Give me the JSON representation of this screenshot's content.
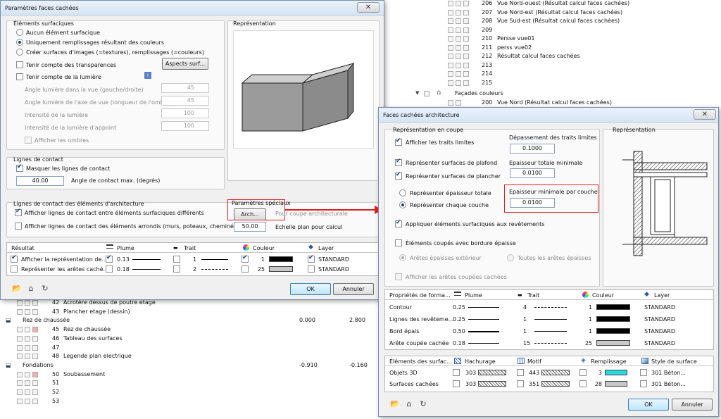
{
  "bg": {
    "top_rows": [
      {
        "num": "206",
        "label": "Vue Nord-ouest (Résultat calcul faces cachées)"
      },
      {
        "num": "207",
        "label": "Vue Nord-est (Résultat calcul faces cachées)"
      },
      {
        "num": "208",
        "label": "Vue Sud-est (Résultat calcul faces cachées)"
      },
      {
        "num": "209",
        "label": ""
      },
      {
        "num": "210",
        "label": "Persse vue01"
      },
      {
        "num": "211",
        "label": "perss vue02"
      },
      {
        "num": "212",
        "label": "Résultat calcul faces cachées"
      },
      {
        "num": "213",
        "label": ""
      },
      {
        "num": "214",
        "label": ""
      },
      {
        "num": "215",
        "label": ""
      }
    ],
    "facades_label": "Façades couleurs",
    "row_200": {
      "num": "200",
      "label": "Vue Nord (Résultat calcul faces cachées)"
    },
    "bottom_rows": [
      {
        "num": "42",
        "label": "Acrotère dessus de poutre etage"
      },
      {
        "num": "43",
        "label": "Plancher etage (dessin)"
      },
      {
        "group": "Rez de chaussée",
        "v1": "0.000",
        "v2": "2.800"
      },
      {
        "num": "45",
        "label": "Rez de chaussée"
      },
      {
        "num": "46",
        "label": "Tableau des surfaces"
      },
      {
        "num": "47",
        "label": ""
      },
      {
        "num": "48",
        "label": "Legende plan electrique"
      },
      {
        "group": "Fondations",
        "v1": "-0.910",
        "v2": "-0.160"
      },
      {
        "num": "50",
        "label": "Soubassement"
      },
      {
        "num": "51",
        "label": ""
      },
      {
        "num": "52",
        "label": ""
      },
      {
        "num": "53",
        "label": ""
      }
    ]
  },
  "dlg1": {
    "title": "Paramètres faces cachées",
    "close": "✕",
    "surf": {
      "title": "Éléments surfaciques",
      "opt1": "Aucun élément surfacique",
      "opt2": "Uniquement remplissages résultant des couleurs",
      "opt3": "Créer surfaces d'images (=textures), remplissages (=couleurs)",
      "transp": "Tenir compte des transparences",
      "aspects_btn": "Aspects surf...",
      "light": "Tenir compte de la lumière",
      "angle1": "Angle lumière dans la vue (gauche/droite)",
      "angle1_val": "45",
      "angle2": "Angle lumière de l'axe de vue (longueur de l'ombre",
      "angle2_val": "45",
      "int1": "Intensité de la lumière",
      "int1_val": "100",
      "int2": "Intensité de la lumière d'appoint",
      "int2_val": "100",
      "shadows": "Afficher les ombres"
    },
    "repr": "Représentation",
    "contact": {
      "title": "Lignes de contact",
      "hide": "Masquer les lignes de contact",
      "angle_val": "40.00",
      "angle_label": "Angle de contact max. (degrés)"
    },
    "arch": {
      "title": "Lignes de contact des éléments d'architecture",
      "opt1": "Afficher lignes de contact entre éléments surfaciques différents",
      "opt2": "Afficher lignes de contact des éléments arrondis (murs, poteaux, cheminées)",
      "special": "Paramètres spéciaux",
      "arch_btn": "Arch...",
      "for_arch": "Pour coupe architecturale",
      "scale_val": "50.00",
      "scale_label": "Echelle plan pour calcul"
    },
    "table": {
      "headers": [
        "Résultat",
        "Plume",
        "Trait",
        "Couleur",
        "Layer"
      ],
      "rows": [
        {
          "label": "Afficher la représentation de...",
          "pen": "0.13",
          "trait": "1",
          "color": "1",
          "layer": "STANDARD"
        },
        {
          "label": "Représenter les arêtes caché...",
          "pen": "0.18",
          "trait": "2",
          "color": "25",
          "layer": "STANDARD"
        }
      ]
    },
    "ok": "OK",
    "cancel": "Annuler"
  },
  "dlg2": {
    "title": "Faces cachées architecture",
    "close": "✕",
    "coupe": {
      "title": "Représentation en coupe",
      "show_limits": "Afficher les traits limites",
      "overrun_label": "Dépassement des traits limites",
      "overrun_val": "0.1000",
      "ceiling": "Représenter surfaces de plafond",
      "floor": "Représenter surfaces de plancher",
      "min_thick_label": "Epaisseur totale minimale",
      "min_thick_val": "0.0100",
      "total": "Représenter épaisseur totale",
      "per_layer": "Représenter chaque couche",
      "min_layer_label": "Epaisseur minimale par couche",
      "min_layer_val": "0.0100",
      "apply": "Appliquer éléments surfaciques aux revêtements",
      "thick_border": "Éléments coupés avec bordure épaisse",
      "ext_edges": "Arêtes épaisses extérieur",
      "all_edges": "Toutes les arêtes épaisses",
      "hidden_edges": "Afficher les arêtes coupées cachées"
    },
    "repr": "Représentation",
    "props": {
      "headers": [
        "Propriétés de forma...",
        "Plume",
        "Trait",
        "Couleur",
        "Layer"
      ],
      "rows": [
        {
          "label": "Contour",
          "pen": "0.25",
          "trait": "4",
          "color": "1",
          "layer": "STANDARD"
        },
        {
          "label": "Lignes des revêteme...",
          "pen": "0.25",
          "trait": "1",
          "color": "1",
          "layer": "STANDARD"
        },
        {
          "label": "Bord épais",
          "pen": "0.50",
          "trait": "1",
          "color": "1",
          "layer": "STANDARD"
        },
        {
          "label": "Arête coupée cachée",
          "pen": "0.18",
          "trait": "15",
          "color": "25",
          "layer": "STANDARD"
        }
      ]
    },
    "surf": {
      "headers": [
        "Éléments des surfac...",
        "Hachurage",
        "Motif",
        "Remplissage",
        "Style de surface"
      ],
      "rows": [
        {
          "label": "Objets 3D",
          "hatch": "303",
          "motif": "443",
          "fill": "3",
          "style": "301 Béton..."
        },
        {
          "label": "Surfaces cachées",
          "hatch": "303",
          "motif": "351",
          "fill": "28",
          "style": "301 Béton..."
        }
      ]
    },
    "ok": "OK",
    "cancel": "Annuler"
  },
  "colors": {
    "fill3": "#2ad8e0",
    "fill28": "#c8c8c8",
    "red": "#e02020"
  }
}
